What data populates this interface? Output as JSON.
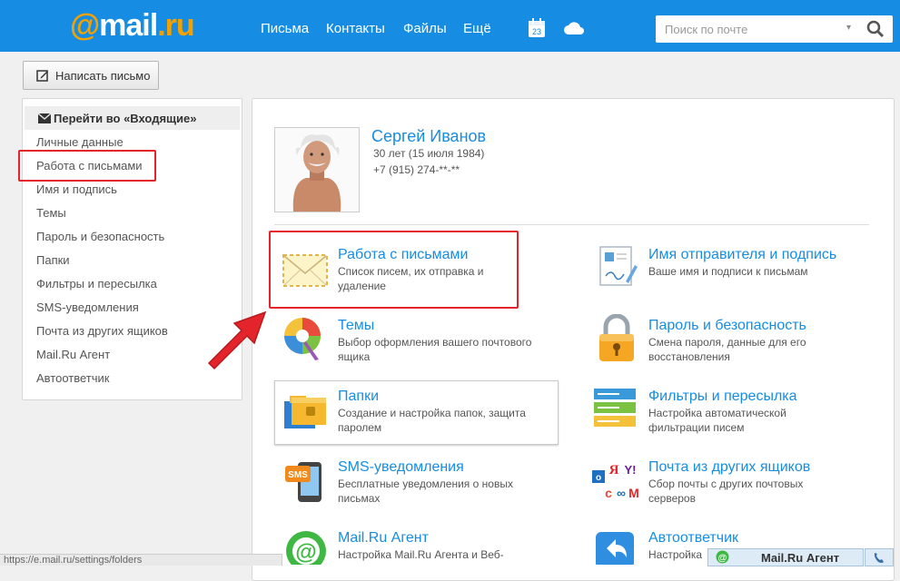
{
  "header": {
    "logo_at": "@",
    "logo_mail": "mail",
    "logo_ru": ".ru",
    "nav": [
      "Письма",
      "Контакты",
      "Файлы",
      "Ещё"
    ],
    "calendar_day": "23",
    "search_placeholder": "Поиск по почте"
  },
  "compose": {
    "label": "Написать письмо"
  },
  "sidebar": {
    "inbox_link": "Перейти во «Входящие»",
    "items": [
      "Личные данные",
      "Работа с письмами",
      "Имя и подпись",
      "Темы",
      "Пароль и безопасность",
      "Папки",
      "Фильтры и пересылка",
      "SMS-уведомления",
      "Почта из других ящиков",
      "Mail.Ru Агент",
      "Автоответчик"
    ]
  },
  "profile": {
    "name": "Сергей Иванов",
    "age": "30 лет (15 июля 1984)",
    "phone": "+7 (915) 274-**-**"
  },
  "tiles": [
    {
      "title": "Работа с письмами",
      "desc": "Список писем, их отправка и удаление",
      "icon": "envelope-icon"
    },
    {
      "title": "Имя отправителя и подпись",
      "desc": "Ваше имя и подписи к письмам",
      "icon": "signature-icon"
    },
    {
      "title": "Темы",
      "desc": "Выбор оформления вашего почтового ящика",
      "icon": "palette-icon"
    },
    {
      "title": "Пароль и безопасность",
      "desc": "Смена пароля, данные для его восстановления",
      "icon": "lock-icon"
    },
    {
      "title": "Папки",
      "desc": "Создание и настройка папок, защита паролем",
      "icon": "folders-icon"
    },
    {
      "title": "Фильтры и пересылка",
      "desc": "Настройка автоматической фильтрации писем",
      "icon": "filters-icon"
    },
    {
      "title": "SMS-уведомления",
      "desc": "Бесплатные уведомления о новых письмах",
      "icon": "sms-phone-icon"
    },
    {
      "title": "Почта из других ящиков",
      "desc": "Сбор почты с других почтовых серверов",
      "icon": "mail-collector-icon"
    },
    {
      "title": "Mail.Ru Агент",
      "desc": "Настройка Mail.Ru Агента и Веб-",
      "icon": "agent-icon"
    },
    {
      "title": "Автоответчик",
      "desc": "Настройка",
      "icon": "autoreply-icon"
    }
  ],
  "statusbar": {
    "url": "https://e.mail.ru/settings/folders"
  },
  "agent_bar": {
    "label": "Mail.Ru Агент"
  },
  "colors": {
    "header": "#168de2",
    "link": "#168de2",
    "highlight": "#e3252b",
    "logo_accent": "#f4a100"
  }
}
